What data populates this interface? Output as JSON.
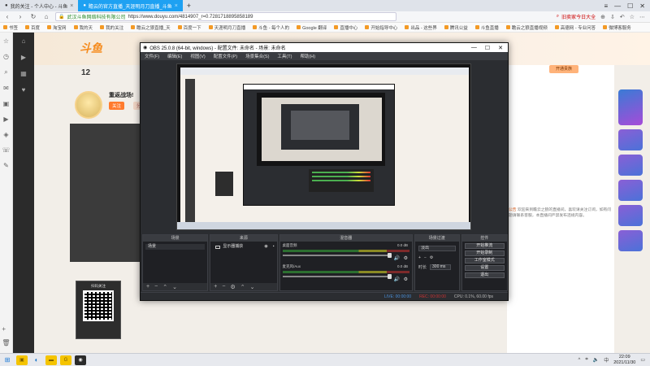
{
  "browser": {
    "tabs": [
      {
        "label": "我的关注 - 个人中心 - 斗鱼",
        "active": false
      },
      {
        "label": "瞻云的官方直播_天涯明月刀直播_斗鱼",
        "active": true
      }
    ],
    "new_tab": "+",
    "url": {
      "secure_label": "武汉斗鱼网络科技有限公司",
      "address": "https://www.douyu.com/4814907_r=0.7281718895858189"
    },
    "search_box": "旧卖家今日大全",
    "bookmarks": [
      "书签",
      "百度",
      "淘宝网",
      "我的天",
      "我的关注",
      "瞻云之狼直播_天",
      "百度一下",
      "天涯明月刀直播",
      "斗鱼 - 每个人的",
      "Google 翻译",
      "直播中心",
      "开始指导中心",
      "出品 - 这些界",
      "腾讯公益",
      "斗鱼直播",
      "瞻云之狼直播视频",
      "高德网 - 专业问答",
      "微博客服务"
    ]
  },
  "douyu": {
    "logo": "斗鱼",
    "fan_count": "12",
    "anchor_name": "重返战场!",
    "follow_label": "关注",
    "second_label": "分享",
    "qr_label": "扫码关注",
    "gift_button": "开通贵族",
    "notice_highlight": "公告",
    "notice_text": "欢迎来到瞻云之狼的直播间，喜欢请关注订阅，如有问题请联系客服，本直播间严禁发布违规内容。"
  },
  "obs": {
    "title": "OBS 25.0.8 (64-bit, windows) - 配置文件: 未命名 - 场景: 未命名",
    "menu": [
      "文件(F)",
      "编辑(E)",
      "视图(V)",
      "配置文件(P)",
      "场景集合(S)",
      "工具(T)",
      "帮助(H)"
    ],
    "docks": {
      "scenes": {
        "title": "场景",
        "items": [
          "场景"
        ]
      },
      "sources": {
        "title": "来源",
        "items": [
          "显示器捕获"
        ]
      },
      "mixer": {
        "title": "混音器",
        "channels": [
          {
            "name": "桌面音频",
            "db": "0.0 dB"
          },
          {
            "name": "麦克风/Aux",
            "db": "0.0 dB"
          }
        ]
      },
      "transitions": {
        "title": "场景过渡",
        "type": "淡出",
        "duration_label": "时长",
        "duration": "300 ms"
      },
      "controls": {
        "title": "控件",
        "buttons": [
          "开始推流",
          "开始录制",
          "工作室模式",
          "设置",
          "退出"
        ]
      }
    },
    "status": {
      "live": "LIVE: 00:00:00",
      "rec": "REC: 00:00:00",
      "cpu": "CPU: 0.1%, 60.00 fps"
    }
  },
  "taskbar": {
    "time": "22:09",
    "date": "2021/11/30",
    "lang": "中"
  }
}
